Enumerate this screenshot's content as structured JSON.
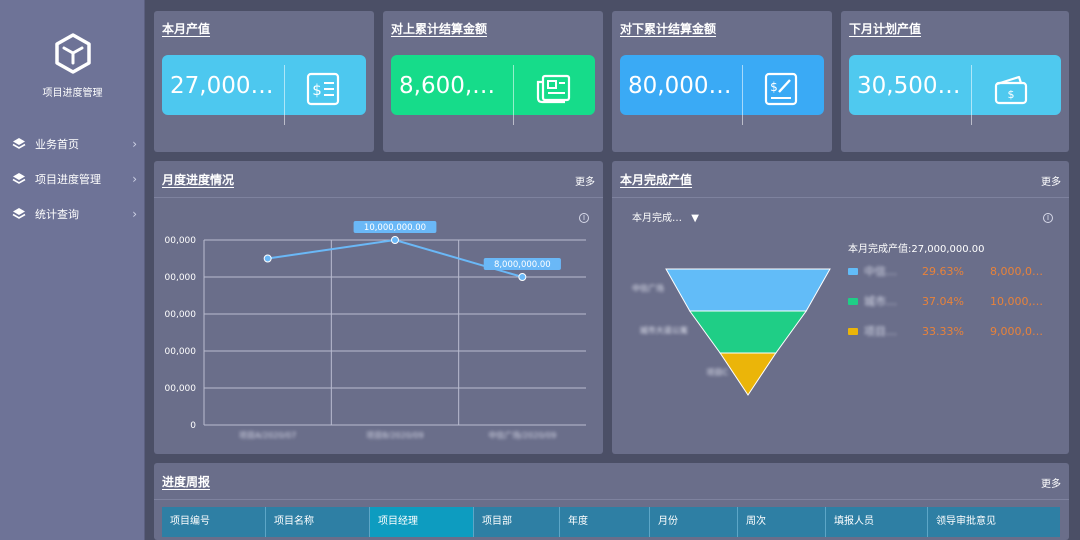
{
  "sidebar": {
    "logo_title": "项目进度管理",
    "items": [
      {
        "label": "业务首页"
      },
      {
        "label": "项目进度管理"
      },
      {
        "label": "统计查询"
      }
    ]
  },
  "kpis": [
    {
      "title": "本月产值",
      "value": "27,000…",
      "color": "#4dc8ef",
      "icon": "invoice-icon"
    },
    {
      "title": "对上累计结算金额",
      "value": "8,600,…",
      "color": "#16dc8a",
      "icon": "newspaper-icon"
    },
    {
      "title": "对下累计结算金额",
      "value": "80,000…",
      "color": "#3aaaf5",
      "icon": "signed-document-icon"
    },
    {
      "title": "下月计划产值",
      "value": "30,500…",
      "color": "#4fc9ef",
      "icon": "wallet-icon"
    }
  ],
  "monthly": {
    "title": "月度进度情况",
    "more": "更多",
    "chart_data": {
      "type": "line",
      "categories": [
        "项目A/2020/07",
        "项目B/2020/09",
        "中信广场/2020/09"
      ],
      "values": [
        9000000,
        10000000,
        8000000
      ],
      "data_labels": [
        "",
        "10,000,000.00",
        "8,000,000.00"
      ],
      "ytick_labels": [
        "0",
        "00,000",
        "00,000",
        "00,000",
        "00,000",
        "00,000"
      ],
      "ylim": [
        0,
        10000000
      ],
      "grid": true,
      "color": "#6ab8f7"
    }
  },
  "completed": {
    "title": "本月完成产值",
    "more": "更多",
    "dropdown": "本月完成…",
    "legend_title": "本月完成产值:27,000,000.00",
    "chart_data": {
      "type": "funnel",
      "labels": [
        "中信广场",
        "城市大道公寓",
        "项目C"
      ],
      "percents": [
        "29.63%",
        "37.04%",
        "33.33%"
      ],
      "amounts": [
        "8,000,0…",
        "10,000,…",
        "9,000,0…"
      ],
      "legend_names": [
        "中信…",
        "城市…",
        "项目…"
      ],
      "colors": [
        "#62bcf8",
        "#1fce86",
        "#ebb509"
      ]
    }
  },
  "weekly": {
    "title": "进度周报",
    "more": "更多",
    "columns": [
      "项目编号",
      "项目名称",
      "项目经理",
      "项目部",
      "年度",
      "月份",
      "周次",
      "填报人员",
      "领导审批意见"
    ]
  }
}
